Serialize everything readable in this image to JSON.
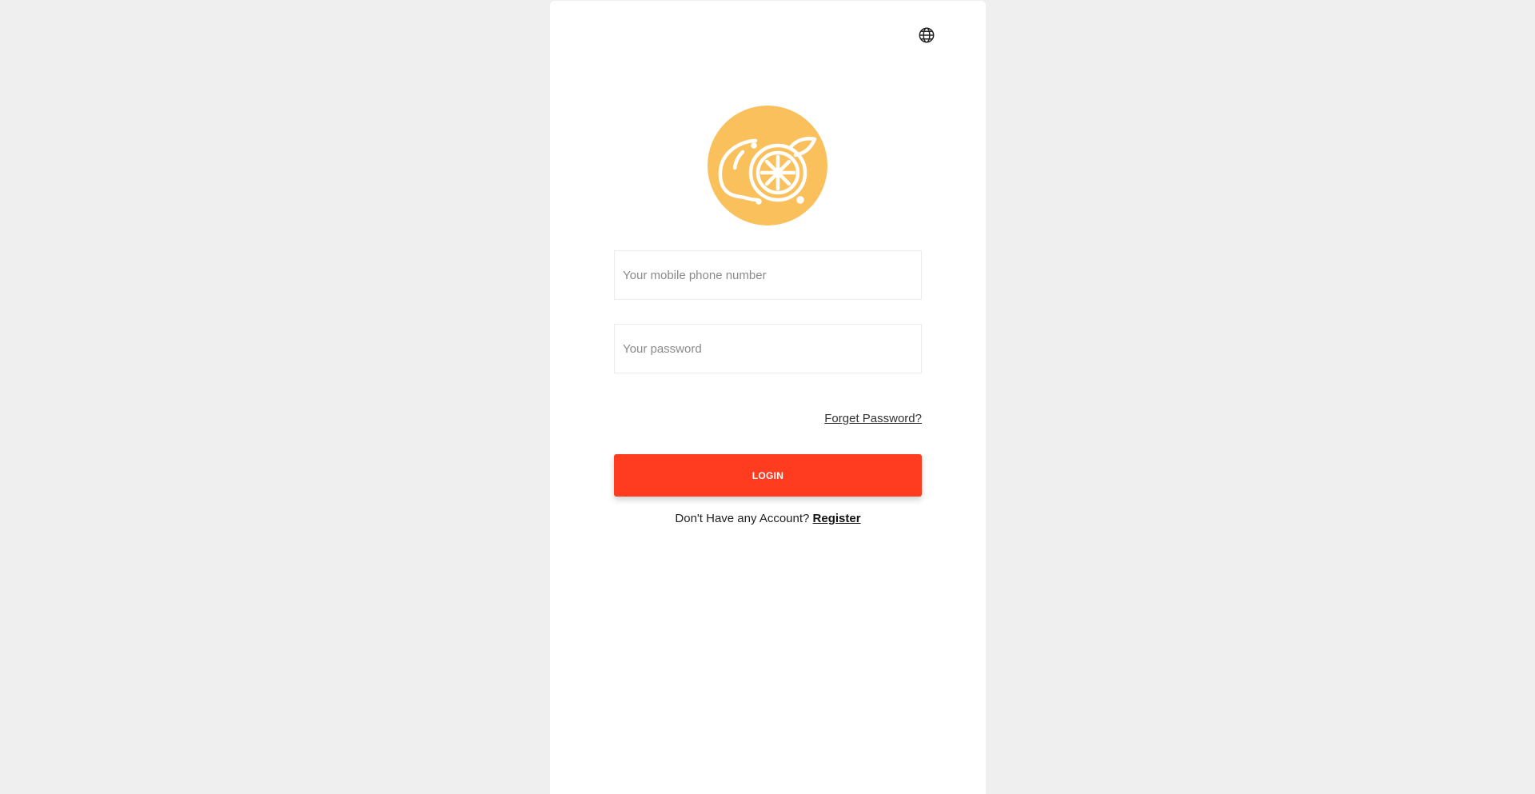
{
  "language": {
    "icon": "globe-icon"
  },
  "logo": {
    "icon": "lemon-logo-icon",
    "background_color": "#f9c05c"
  },
  "form": {
    "phone_placeholder": "Your mobile phone number",
    "password_placeholder": "Your password",
    "forgot_password": "Forget Password?",
    "login_button": "LOGIN",
    "login_color": "#ff3b20",
    "no_account_text": "Don't Have any Account?",
    "register_link": "Register"
  }
}
